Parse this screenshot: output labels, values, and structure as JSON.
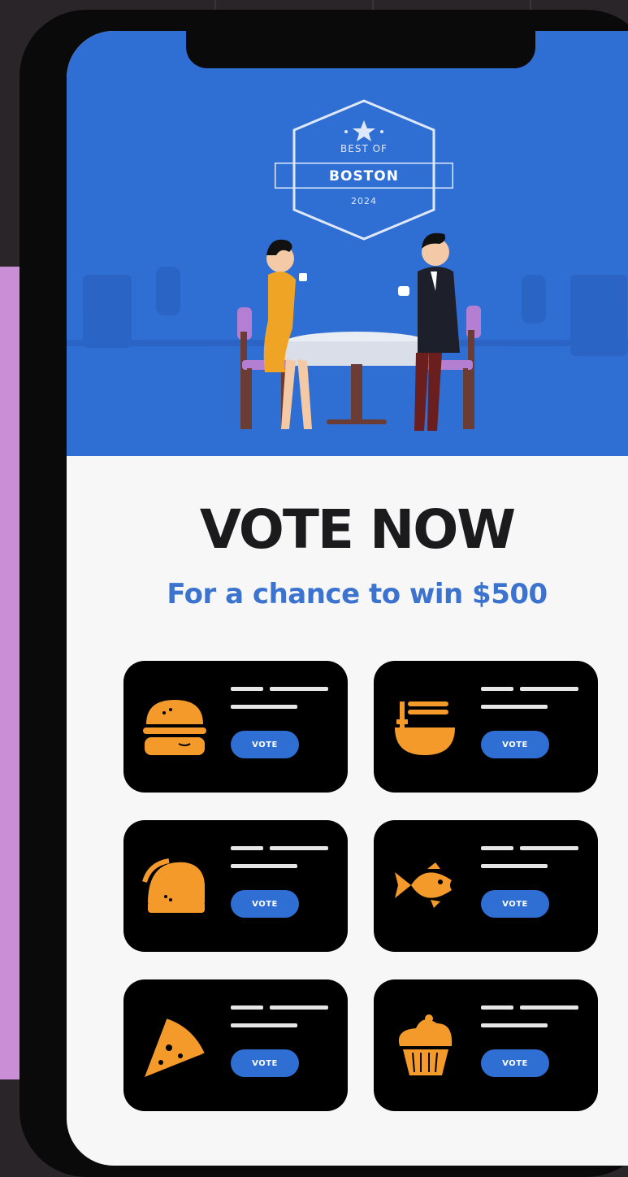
{
  "badge": {
    "top_text": "BEST OF",
    "city": "BOSTON",
    "year": "2024"
  },
  "headline": "VOTE NOW",
  "subheadline": "For a chance to win $500",
  "colors": {
    "hero_blue": "#2f6fd4",
    "accent_orange": "#f39a2b",
    "card_black": "#000000",
    "subhead_blue": "#3b73cf"
  },
  "categories": [
    {
      "icon": "burger-icon",
      "button_label": "VOTE"
    },
    {
      "icon": "noodle-bowl-icon",
      "button_label": "VOTE"
    },
    {
      "icon": "taco-icon",
      "button_label": "VOTE"
    },
    {
      "icon": "fish-icon",
      "button_label": "VOTE"
    },
    {
      "icon": "pizza-slice-icon",
      "button_label": "VOTE"
    },
    {
      "icon": "cupcake-icon",
      "button_label": "VOTE"
    }
  ]
}
